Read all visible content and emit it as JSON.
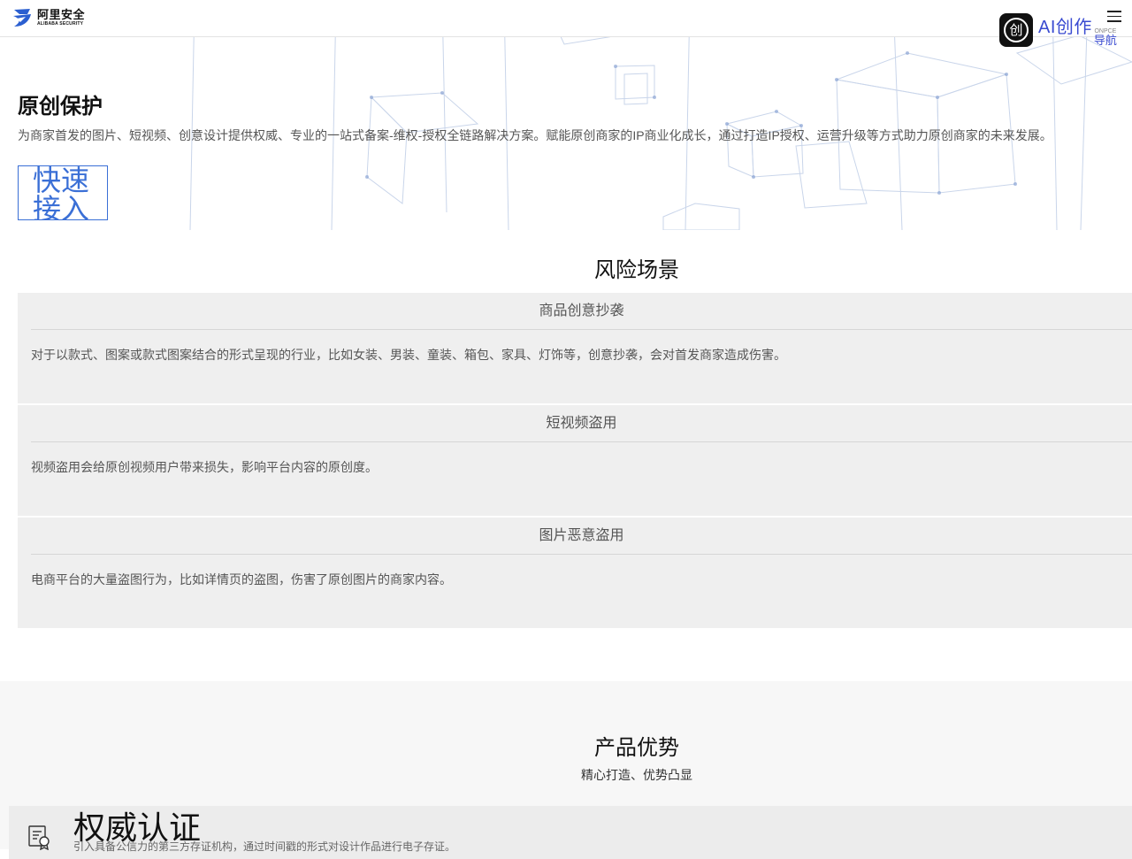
{
  "header": {
    "logo_cn": "阿里安全",
    "logo_en": "ALIBABA SECURITY",
    "logo_icon": "alibaba-security-logo",
    "ai_badge": {
      "icon_glyph": "创",
      "main": "AI创作",
      "sub_small": "ONPCE",
      "sub": "导航"
    },
    "menu_icon": "hamburger-menu-icon"
  },
  "hero": {
    "title": "原创保护",
    "description": "为商家首发的图片、短视频、创意设计提供权威、专业的一站式备案-维权-授权全链路解决方案。赋能原创商家的IP商业化成长，通过打造IP授权、运营升级等方式助力原创商家的未来发展。",
    "quick_button": "快速接入"
  },
  "risk": {
    "title": "风险场景",
    "cards": [
      {
        "title": "商品创意抄袭",
        "body": "对于以款式、图案或款式图案结合的形式呈现的行业，比如女装、男装、童装、箱包、家具、灯饰等，创意抄袭，会对首发商家造成伤害。"
      },
      {
        "title": "短视频盗用",
        "body": "视频盗用会给原创视频用户带来损失，影响平台内容的原创度。"
      },
      {
        "title": "图片恶意盗用",
        "body": "电商平台的大量盗图行为，比如详情页的盗图，伤害了原创图片的商家内容。"
      }
    ]
  },
  "advantages": {
    "title": "产品优势",
    "subtitle": "精心打造、优势凸显",
    "cards": [
      {
        "icon": "certificate-icon",
        "title": "权威认证",
        "body": "引入具备公信力的第三方存证机构，通过时间戳的形式对设计作品进行电子存证。"
      }
    ]
  },
  "colors": {
    "accent": "#3a6fd6",
    "ai_brand": "#3a4bd1",
    "card_bg": "#efefef",
    "section_bg": "#f7f7f7"
  }
}
